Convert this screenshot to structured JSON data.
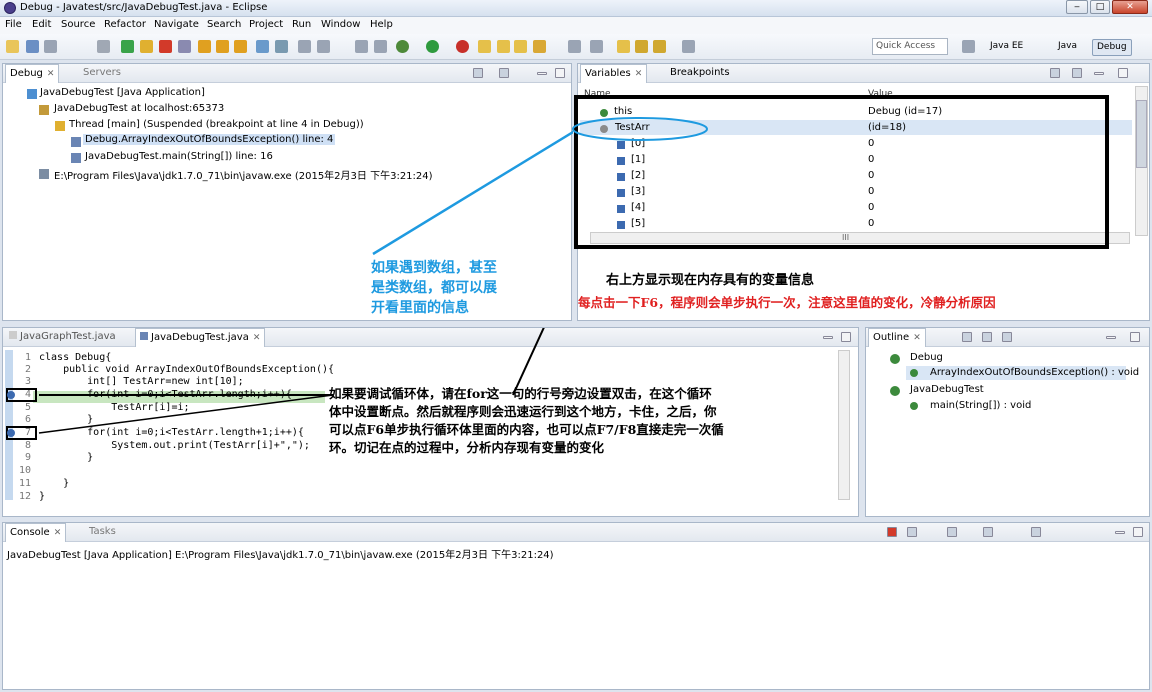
{
  "window": {
    "title": "Debug - Javatest/src/JavaDebugTest.java - Eclipse",
    "min": "‒",
    "max": "□",
    "close": "✕"
  },
  "menu": [
    "File",
    "Edit",
    "Source",
    "Refactor",
    "Navigate",
    "Search",
    "Project",
    "Run",
    "Window",
    "Help"
  ],
  "toolbar": {
    "quick_access": "Quick Access",
    "perspectives": [
      "Java EE",
      "Java",
      "Debug"
    ]
  },
  "debug_view": {
    "tabs": [
      "Debug",
      "Servers"
    ],
    "tree": [
      "JavaDebugTest [Java Application]",
      "JavaDebugTest at localhost:65373",
      "Thread [main] (Suspended (breakpoint at line 4 in Debug))",
      "Debug.ArrayIndexOutOfBoundsException() line: 4",
      "JavaDebugTest.main(String[]) line: 16",
      "E:\\Program Files\\Java\\jdk1.7.0_71\\bin\\javaw.exe (2015年2月3日 下午3:21:24)"
    ]
  },
  "variables_view": {
    "tabs": [
      "Variables",
      "Breakpoints"
    ],
    "columns": [
      "Name",
      "Value"
    ],
    "rows": [
      {
        "name": "this",
        "value": "Debug  (id=17)"
      },
      {
        "name": "TestArr",
        "value": "(id=18)"
      },
      {
        "name": "[0]",
        "value": "0"
      },
      {
        "name": "[1]",
        "value": "0"
      },
      {
        "name": "[2]",
        "value": "0"
      },
      {
        "name": "[3]",
        "value": "0"
      },
      {
        "name": "[4]",
        "value": "0"
      },
      {
        "name": "[5]",
        "value": "0"
      }
    ],
    "hscroll_mark": "III"
  },
  "annotations": {
    "array_note": [
      "如果遇到数组，甚至",
      "是类数组，都可以展",
      "开看里面的信息"
    ],
    "vars_note": "右上方显示现在内存具有的变量信息",
    "f6_note": "每点击一下F6，程序则会单步执行一次，注意这里值的变化，冷静分析原因",
    "loop_note": [
      "如果要调试循环体，请在for这一句的行号旁边设置双击，在这个循环",
      "体中设置断点。然后就程序则会迅速运行到这个地方，卡住，之后，你",
      "可以点F6单步执行循环体里面的内容，也可以点F7/F8直接走完一次循",
      "环。切记在点的过程中，分析内存现有变量的变化"
    ]
  },
  "editor": {
    "tabs": [
      "JavaGraphTest.java",
      "JavaDebugTest.java"
    ],
    "line_numbers": [
      "1",
      "2",
      "3",
      "4",
      "5",
      "6",
      "7",
      "8",
      "9",
      "10",
      "11",
      "12"
    ],
    "lines": [
      "class Debug{",
      "    public void ArrayIndexOutOfBoundsException(){",
      "        int[] TestArr=new int[10];",
      "        for(int i=0;i<TestArr.length;i++){",
      "            TestArr[i]=i;",
      "        }",
      "        for(int i=0;i<TestArr.length+1;i++){",
      "            System.out.print(TestArr[i]+\",\");",
      "        }",
      "",
      "    }",
      "}"
    ]
  },
  "outline": {
    "tab": "Outline",
    "items": [
      "Debug",
      "ArrayIndexOutOfBoundsException() : void",
      "JavaDebugTest",
      "main(String[]) : void"
    ]
  },
  "console": {
    "tabs": [
      "Console",
      "Tasks"
    ],
    "text": "JavaDebugTest [Java Application] E:\\Program Files\\Java\\jdk1.7.0_71\\bin\\javaw.exe (2015年2月3日 下午3:21:24)"
  }
}
